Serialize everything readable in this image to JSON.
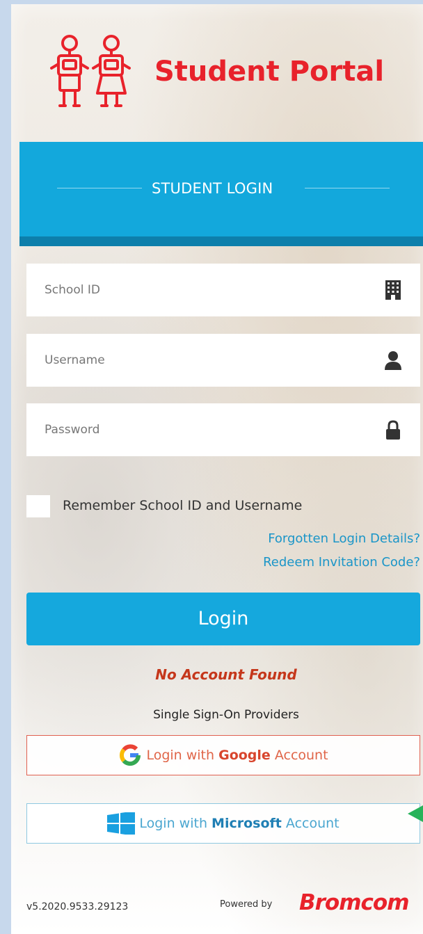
{
  "header": {
    "title": "Student Portal",
    "logo_icon": "robot-students-icon",
    "brand_color": "#e8222b"
  },
  "banner": {
    "title": "STUDENT LOGIN",
    "color": "#13a8dc"
  },
  "form": {
    "school_id_placeholder": "School ID",
    "username_placeholder": "Username",
    "password_placeholder": "Password",
    "remember_label": "Remember School ID and Username",
    "remember_checked": false
  },
  "links": {
    "forgotten": "Forgotten Login Details?",
    "redeem": "Redeem Invitation Code?"
  },
  "login_button": "Login",
  "error_message": "No Account Found",
  "sso": {
    "heading": "Single Sign-On Providers",
    "google": {
      "prefix": "Login with ",
      "provider": "Google",
      "suffix": " Account"
    },
    "microsoft": {
      "prefix": "Login with ",
      "provider": "Microsoft",
      "suffix": " Account"
    }
  },
  "footer": {
    "version": "v5.2020.9533.29123",
    "powered_by": "Powered by",
    "brand": "Bromcom"
  }
}
